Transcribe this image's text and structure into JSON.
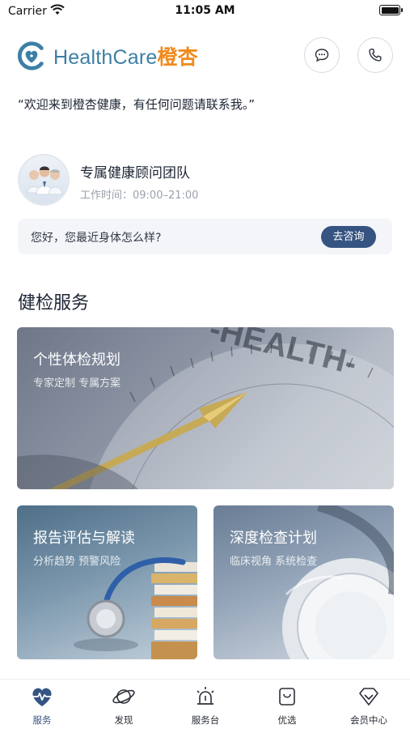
{
  "status_bar": {
    "carrier": "Carrier",
    "time": "11:05 AM"
  },
  "header": {
    "brand_en": "HealthCare",
    "brand_cn": "橙杏"
  },
  "greeting": "“欢迎来到橙杏健康，有任何问题请联系我。”",
  "advisor": {
    "name": "专属健康顾问团队",
    "hours": "工作时间：09:00–21:00",
    "message": "您好，您最近身体怎么样?",
    "consult_label": "去咨询"
  },
  "section": {
    "title": "健检服务"
  },
  "cards": [
    {
      "title": "个性体检规划",
      "subtitle": "专家定制 专属方案",
      "art_text": "-HEALTH-"
    },
    {
      "title": "报告评估与解读",
      "subtitle": "分析趋势 预警风险"
    },
    {
      "title": "深度检查计划",
      "subtitle": "临床视角 系统检查"
    }
  ],
  "tabbar": {
    "active": "服务",
    "items": [
      {
        "label": "服务",
        "icon": "heartbeat-icon"
      },
      {
        "label": "发现",
        "icon": "planet-icon"
      },
      {
        "label": "服务台",
        "icon": "alarm-light-icon"
      },
      {
        "label": "优选",
        "icon": "shopping-bag-icon"
      },
      {
        "label": "会员中心",
        "icon": "diamond-icon"
      }
    ]
  },
  "colors": {
    "brand_blue": "#3d7fa5",
    "brand_orange": "#f08a1c",
    "accent_navy": "#365481"
  }
}
